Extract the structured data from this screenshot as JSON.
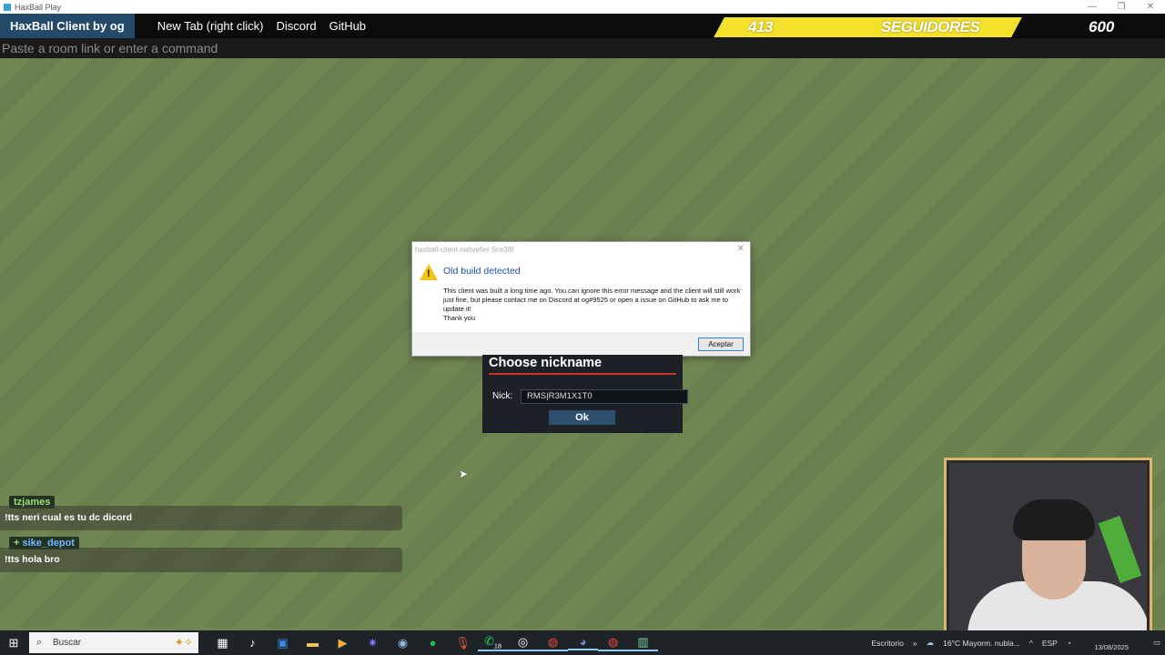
{
  "window": {
    "title": "HaxBall Play",
    "controls": [
      "—",
      "❐",
      "✕"
    ]
  },
  "navbar": {
    "brand": "HaxBall Client by og",
    "links": [
      "New Tab (right click)",
      "Discord",
      "GitHub"
    ]
  },
  "stream_overlay": {
    "current": "413",
    "label": "SEGUIDORES",
    "goal": "600",
    "goal_color": "#f3e12c"
  },
  "command_bar": {
    "placeholder": "Paste a room link or enter a command"
  },
  "message_box": {
    "title": "haxball-client-nativefier-5ce38f",
    "heading": "Old build detected",
    "body": "This client was built a long time ago. You can ignore this error message and the client will still work just fine, but please contact me on Discord at og#9525 or open a issue on GitHub to ask me to update it!",
    "thanks": "Thank you",
    "ok_label": "Aceptar",
    "icon": "warning-icon",
    "heading_color": "#1f4fa0"
  },
  "nickname_dialog": {
    "title": "Choose nickname",
    "nick_label": "Nick:",
    "nick_value": "RMS|R3M1X1T0",
    "ok_label": "Ok"
  },
  "chat": [
    {
      "user": "tzjames",
      "message": "!tts neri cual es tu dc dicord"
    },
    {
      "user": "sike_depot",
      "message": "!tts hola bro",
      "badge": "+"
    }
  ],
  "taskbar": {
    "search_placeholder": "Buscar",
    "apps": [
      "task-view-icon",
      "tiktok-icon",
      "outlook-icon",
      "file-explorer-icon",
      "app-icon",
      "star-icon",
      "steam-icon",
      "spotify-icon",
      "microphone-icon",
      "whatsapp-icon",
      "obs-icon",
      "chrome-icon",
      "discord-icon",
      "chrome-icon",
      "haxball-icon"
    ],
    "whatsapp_count": "18",
    "desktop_label": "Escritorio",
    "weather": "16°C  Mayorm. nubla...",
    "language": "ESP",
    "date": "13/08/2025"
  }
}
